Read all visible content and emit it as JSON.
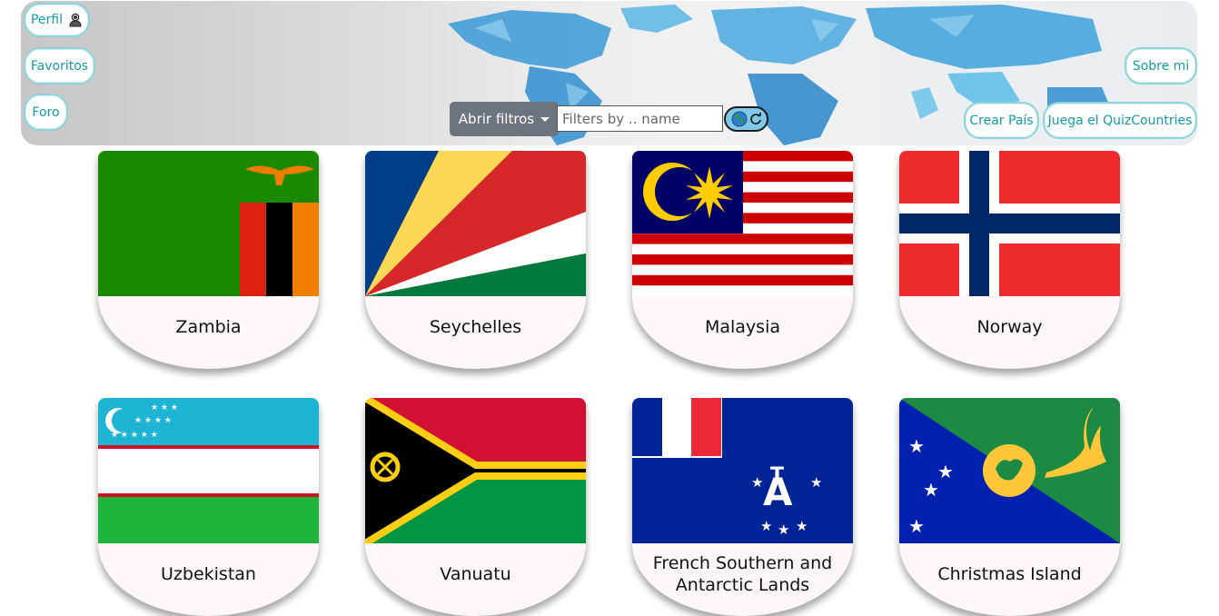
{
  "header": {
    "perfil": "Perfil",
    "favoritos": "Favoritos",
    "foro": "Foro",
    "sobre_mi": "Sobre mi",
    "crear_pais": "Crear País",
    "quiz": "Juega el QuizCountries",
    "filters_button": "Abrir filtros",
    "search_placeholder": "Filters by .. name",
    "search_value": "",
    "profile_icon": "user-icon",
    "globe_icon": "globe-icon",
    "reload_icon": "reload-icon"
  },
  "countries": [
    {
      "name": "Zambia"
    },
    {
      "name": "Seychelles"
    },
    {
      "name": "Malaysia"
    },
    {
      "name": "Norway"
    },
    {
      "name": "Uzbekistan"
    },
    {
      "name": "Vanuatu"
    },
    {
      "name": "French Southern and Antarctic Lands"
    },
    {
      "name": "Christmas Island"
    }
  ],
  "colors": {
    "accent": "#149aa6",
    "pill_border": "#8fd3d9",
    "filters_button": "#6c757d",
    "card_bg": "#fff7f7"
  }
}
